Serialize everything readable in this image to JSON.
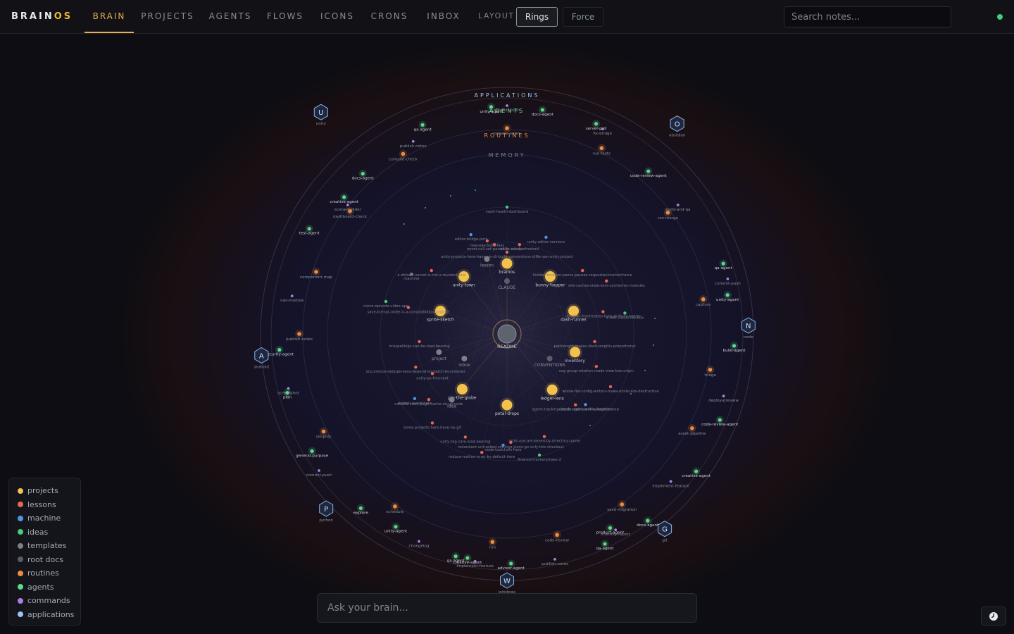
{
  "app": {
    "logo_main": "BRAIN",
    "logo_accent": "OS"
  },
  "nav": {
    "tabs": [
      "BRAIN",
      "PROJECTS",
      "AGENTS",
      "FLOWS",
      "ICONS",
      "CRONS",
      "INBOX"
    ],
    "active": "BRAIN",
    "layout_label": "LAYOUT",
    "layout_options": [
      "Rings",
      "Force"
    ],
    "layout_selected": "Rings"
  },
  "search": {
    "placeholder": "Search notes..."
  },
  "ask": {
    "placeholder": "Ask your brain..."
  },
  "colors": {
    "projects": "#f2c14e",
    "lessons": "#e8674f",
    "machine": "#4d96e0",
    "ideas": "#4cc97a",
    "templates": "#7c8089",
    "root_docs": "#5a5e68",
    "routines": "#f08d3c",
    "agents": "#5ed88a",
    "commands": "#b07ee0",
    "applications": "#9fc3f2",
    "accent": "#e8b04a"
  },
  "legend": [
    {
      "label": "projects",
      "color": "#f2c14e"
    },
    {
      "label": "lessons",
      "color": "#e8674f"
    },
    {
      "label": "machine",
      "color": "#4d96e0"
    },
    {
      "label": "ideas",
      "color": "#4cc97a"
    },
    {
      "label": "templates",
      "color": "#7c8089"
    },
    {
      "label": "root docs",
      "color": "#5a5e68"
    },
    {
      "label": "routines",
      "color": "#f08d3c"
    },
    {
      "label": "agents",
      "color": "#5ed88a"
    },
    {
      "label": "commands",
      "color": "#b07ee0"
    },
    {
      "label": "applications",
      "color": "#9fc3f2"
    }
  ],
  "ring_labels": {
    "applications": "APPLICATIONS",
    "agents": "AGENTS",
    "routines": "ROUTINES",
    "memory": "MEMORY"
  },
  "center": {
    "label": "README",
    "type": "root"
  },
  "applications": [
    {
      "letter": "U",
      "label": "unity"
    },
    {
      "letter": "O",
      "label": "obsidian"
    },
    {
      "letter": "N",
      "label": "node"
    },
    {
      "letter": "G",
      "label": "git"
    },
    {
      "letter": "W",
      "label": "windows"
    },
    {
      "letter": "P",
      "label": "python"
    },
    {
      "letter": "A",
      "label": "android"
    }
  ],
  "inner_nodes": [
    {
      "label": "brainos",
      "type": "projects"
    },
    {
      "label": "unity-town",
      "type": "projects"
    },
    {
      "label": "bunny-hopper",
      "type": "projects"
    },
    {
      "label": "sprite-sketch",
      "type": "projects"
    },
    {
      "label": "dash-runner",
      "type": "projects"
    },
    {
      "label": "project",
      "type": "templates"
    },
    {
      "label": "inventory",
      "type": "projects"
    },
    {
      "label": "pin-the-globe",
      "type": "projects"
    },
    {
      "label": "ledger-lens",
      "type": "projects"
    },
    {
      "label": "petal-drops",
      "type": "projects"
    },
    {
      "label": "CLAUDE",
      "type": "root_docs"
    },
    {
      "label": "inbox",
      "type": "templates"
    },
    {
      "label": "CONVENTIONS",
      "type": "root_docs"
    },
    {
      "label": "idea",
      "type": "templates"
    },
    {
      "label": "lesson",
      "type": "templates"
    }
  ],
  "memory_nodes": [
    {
      "label": "vault-health-dashboard",
      "type": "ideas"
    },
    {
      "label": "editor-bridge-port",
      "type": "machine"
    },
    {
      "label": "unity-editor-versions",
      "type": "machine"
    },
    {
      "label": "never-call-set-parent-in-a-loop",
      "type": "lessons"
    },
    {
      "label": "skills-need-refreshed",
      "type": "lessons"
    },
    {
      "label": "unity-projects-here-have-no-cli-build-conventions-differ-per-unity-project",
      "type": "lessons"
    },
    {
      "label": "hidden-browser-panes-pauses-requestanimationframe",
      "type": "lessons"
    },
    {
      "label": "a-default-secret-is-not-a-revoked-one",
      "type": "lessons"
    },
    {
      "label": "machine",
      "type": "templates"
    },
    {
      "label": "vite-caches-stale-esm-cached-es-modules",
      "type": "lessons"
    },
    {
      "label": "micro-episode-video-app",
      "type": "ideas"
    },
    {
      "label": "save-format-order-is-a-compatibility-contract",
      "type": "lessons"
    },
    {
      "label": "obsidian-frontmatter-lives-in-front-matter",
      "type": "lessons"
    },
    {
      "label": "a-feel-studio-ina-box",
      "type": "ideas"
    },
    {
      "label": "misspellings-can-be-load-bearing",
      "type": "lessons"
    },
    {
      "label": "pathlength-makes-dash-lengths-proportional",
      "type": "lessons"
    },
    {
      "label": "occurrence-dedupe-keys-depend-on-batch-boundaries",
      "type": "lessons"
    },
    {
      "label": "svg-group-rotation-reads-view-box-origin",
      "type": "lessons"
    },
    {
      "label": "python-is-not-here",
      "type": "machine"
    },
    {
      "label": "unity-no-free-text",
      "type": "lessons"
    },
    {
      "label": "whole-file-config-writers-make-old-builds-destructive",
      "type": "lessons"
    },
    {
      "label": "console-code-page-cache-on-unicode",
      "type": "lessons"
    },
    {
      "label": "claude-code-on-this-machine",
      "type": "machine"
    },
    {
      "label": "agent-tracking-needs-agent-and-subagent-stop",
      "type": "lessons"
    },
    {
      "label": "some-projects-here-have-no-git",
      "type": "lessons"
    },
    {
      "label": "unity-tag-care-load-bearing",
      "type": "lessons"
    },
    {
      "label": "skills-use-are-keyed-by-directory-name",
      "type": "lessons"
    },
    {
      "label": "reduce-motion-is-on-by-default-here",
      "type": "lessons"
    },
    {
      "label": "node-toolchain-here",
      "type": "machine"
    },
    {
      "label": "finance-tracker-phase-2",
      "type": "ideas"
    },
    {
      "label": "redundant-untracked-settings-jsons-go-only-this-checkout",
      "type": "lessons"
    },
    {
      "label": "new-eas-build-fails",
      "type": "lessons"
    }
  ],
  "routine_nodes": [
    {
      "label": "release-notes",
      "type": "routines"
    },
    {
      "label": "compile-check",
      "type": "routines"
    },
    {
      "label": "run-tests",
      "type": "routines"
    },
    {
      "label": "dashboard-check",
      "type": "routines"
    },
    {
      "label": "csv-merge",
      "type": "routines"
    },
    {
      "label": "component-map",
      "type": "routines"
    },
    {
      "label": "capture",
      "type": "routines"
    },
    {
      "label": "publish-notes",
      "type": "routines"
    },
    {
      "label": "triage",
      "type": "routines"
    },
    {
      "label": "simplify",
      "type": "routines"
    },
    {
      "label": "asset-pipeline",
      "type": "routines"
    },
    {
      "label": "schedule",
      "type": "routines"
    },
    {
      "label": "save-migration",
      "type": "routines"
    },
    {
      "label": "run",
      "type": "routines"
    },
    {
      "label": "code-review",
      "type": "routines"
    }
  ],
  "agent_nodes": [
    {
      "label": "unity-agent",
      "type": "agents"
    },
    {
      "label": "commit-push",
      "type": "commands"
    },
    {
      "label": "docs-agent",
      "type": "agents"
    },
    {
      "label": "qa-agent",
      "type": "agents"
    },
    {
      "label": "publish-notes",
      "type": "commands"
    },
    {
      "label": "server-pull",
      "type": "agents"
    },
    {
      "label": "fix-bridge",
      "type": "commands"
    },
    {
      "label": "docs-agent",
      "type": "agents"
    },
    {
      "label": "code-review-agent",
      "type": "agents"
    },
    {
      "label": "creative-agent",
      "type": "agents"
    },
    {
      "label": "scene-builder",
      "type": "commands"
    },
    {
      "label": "build-and-qa",
      "type": "commands"
    },
    {
      "label": "test-agent",
      "type": "agents"
    },
    {
      "label": "qa-agent",
      "type": "agents"
    },
    {
      "label": "nav-module",
      "type": "commands"
    },
    {
      "label": "commit-push",
      "type": "commands"
    },
    {
      "label": "unity-agent",
      "type": "agents"
    },
    {
      "label": "security-agent",
      "type": "agents"
    },
    {
      "label": "build-agent",
      "type": "agents"
    },
    {
      "label": "screenshot",
      "type": "commands"
    },
    {
      "label": "plan",
      "type": "agents"
    },
    {
      "label": "deploy-preview",
      "type": "commands"
    },
    {
      "label": "code-review-agent",
      "type": "agents"
    },
    {
      "label": "general-purpose",
      "type": "agents"
    },
    {
      "label": "creative-agent",
      "type": "agents"
    },
    {
      "label": "commit-push",
      "type": "commands"
    },
    {
      "label": "implement-feature",
      "type": "commands"
    },
    {
      "label": "explore",
      "type": "agents"
    },
    {
      "label": "docs-agent",
      "type": "agents"
    },
    {
      "label": "unity-agent",
      "type": "agents"
    },
    {
      "label": "changelog",
      "type": "commands"
    },
    {
      "label": "product-agent",
      "type": "agents"
    },
    {
      "label": "monthly-report",
      "type": "commands"
    },
    {
      "label": "qa-agent",
      "type": "agents"
    },
    {
      "label": "qa-agent",
      "type": "agents"
    },
    {
      "label": "creative-agent",
      "type": "agents"
    },
    {
      "label": "implement-feature",
      "type": "commands"
    },
    {
      "label": "advisor-agent",
      "type": "agents"
    },
    {
      "label": "publish-notes",
      "type": "commands"
    }
  ]
}
